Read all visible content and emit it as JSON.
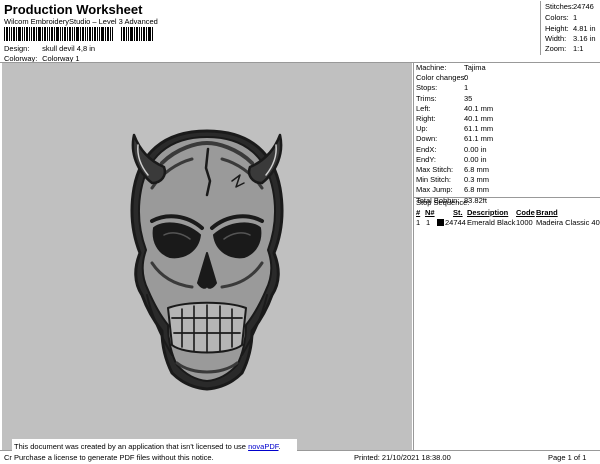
{
  "header": {
    "title": "Production Worksheet",
    "subtitle": "Wilcom EmbroideryStudio – Level 3 Advanced",
    "design_label": "Design:",
    "design_value": "skull devil 4,8 in",
    "colorway_label": "Colorway:",
    "colorway_value": "Colorway 1"
  },
  "summary": {
    "stitches_label": "Stitches:",
    "stitches_value": "24746",
    "colors_label": "Colors:",
    "colors_value": "1",
    "height_label": "Height:",
    "height_value": "4.81 in",
    "width_label": "Width:",
    "width_value": "3.16 in",
    "zoom_label": "Zoom:",
    "zoom_value": "1:1"
  },
  "properties": [
    {
      "label": "Machine:",
      "value": "Tajima"
    },
    {
      "label": "Color changes:",
      "value": "0"
    },
    {
      "label": "Stops:",
      "value": "1"
    },
    {
      "label": "Trims:",
      "value": "35"
    },
    {
      "label": "Left:",
      "value": "40.1 mm"
    },
    {
      "label": "Right:",
      "value": "40.1 mm"
    },
    {
      "label": "Up:",
      "value": "61.1 mm"
    },
    {
      "label": "Down:",
      "value": "61.1 mm"
    },
    {
      "label": "EndX:",
      "value": "0.00 in"
    },
    {
      "label": "EndY:",
      "value": "0.00 in"
    },
    {
      "label": "Max Stitch:",
      "value": "6.8 mm"
    },
    {
      "label": "Min Stitch:",
      "value": "0.3 mm"
    },
    {
      "label": "Max Jump:",
      "value": "6.8 mm"
    },
    {
      "label": "Total Bobbin:",
      "value": "83.82ft"
    }
  ],
  "stop_sequence": {
    "title": "Stop Sequence:",
    "headers": {
      "num": "#",
      "n_num": "N#",
      "st": "St.",
      "description": "Description",
      "code": "Code",
      "brand": "Brand"
    },
    "rows": [
      {
        "num": "1",
        "n_num": "1",
        "st": "24744",
        "description": "Emerald Black",
        "code": "1000",
        "brand": "Madeira Classic 40",
        "color": "#000000"
      }
    ]
  },
  "footer": {
    "left": "Cr",
    "printed": "Printed: 21/10/2021 18:38.00",
    "page": "Page 1 of 1"
  },
  "notice": {
    "line1_prefix": "This document was created by an application that isn't licensed to use",
    "link": "novaPDF",
    "line1_suffix": ".",
    "line2": "Purchase a license to generate PDF files without this notice."
  },
  "colors": {
    "canvas_bg": "#c0c0c0",
    "thread": "#1a1a1a"
  }
}
